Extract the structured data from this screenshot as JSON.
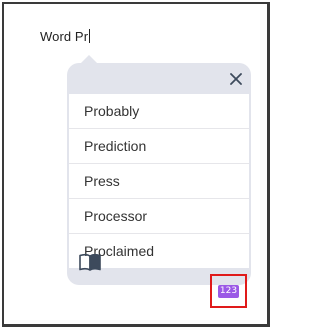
{
  "editor": {
    "typed_text": "Word Pr"
  },
  "popup": {
    "close_icon": "close-icon",
    "suggestions": [
      {
        "label": "Probably"
      },
      {
        "label": "Prediction"
      },
      {
        "label": "Press"
      },
      {
        "label": "Processor"
      },
      {
        "label": "Proclaimed"
      }
    ],
    "footer": {
      "dictionary_icon": "book-icon",
      "numeric_keypad_label": "123",
      "numeric_keypad_color": "#9b59e6",
      "highlight_color": "#e01a1a"
    }
  }
}
